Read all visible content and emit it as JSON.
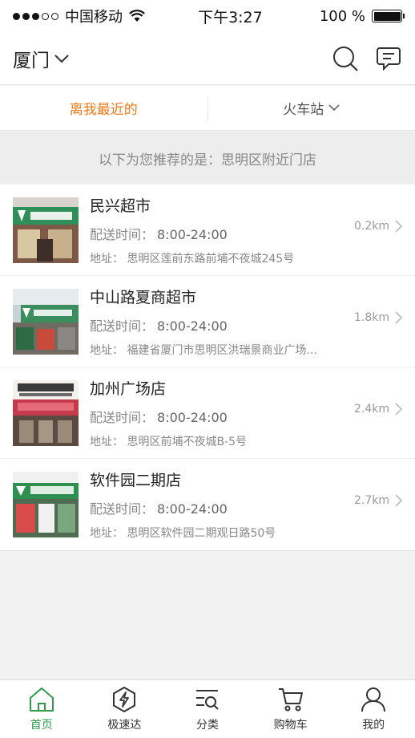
{
  "status_bar": {
    "carrier": "中国移动",
    "time": "下午3:27",
    "battery": "100 %"
  },
  "header": {
    "city": "厦门"
  },
  "filters": {
    "nearest": "离我最近的",
    "station": "火车站"
  },
  "recommend_text": "以下为您推荐的是：思明区附近门店",
  "stores": [
    {
      "name": "民兴超市",
      "time_label": "配送时间：",
      "time": "8:00-24:00",
      "address": "地址：  思明区莲前东路前埔不夜城245号",
      "distance": "0.2km"
    },
    {
      "name": "中山路夏商超市",
      "time_label": "配送时间：",
      "time": "8:00-24:00",
      "address": "地址：  福建省厦门市思明区洪瑞景商业广场...",
      "distance": "1.8km"
    },
    {
      "name": "加州广场店",
      "time_label": "配送时间：",
      "time": "8:00-24:00",
      "address": "地址：  思明区前埔不夜城B-5号",
      "distance": "2.4km"
    },
    {
      "name": "软件园二期店",
      "time_label": "配送时间：",
      "time": "8:00-24:00",
      "address": "地址：  思明区软件园二期观日路50号",
      "distance": "2.7km"
    }
  ],
  "tabs": [
    {
      "label": "首页",
      "icon": "home-icon"
    },
    {
      "label": "极速达",
      "icon": "lightning-icon"
    },
    {
      "label": "分类",
      "icon": "category-search-icon"
    },
    {
      "label": "购物车",
      "icon": "cart-icon"
    },
    {
      "label": "我的",
      "icon": "user-icon"
    }
  ],
  "colors": {
    "active_filter": "#f07a17",
    "active_tab": "#2f9b4b"
  }
}
